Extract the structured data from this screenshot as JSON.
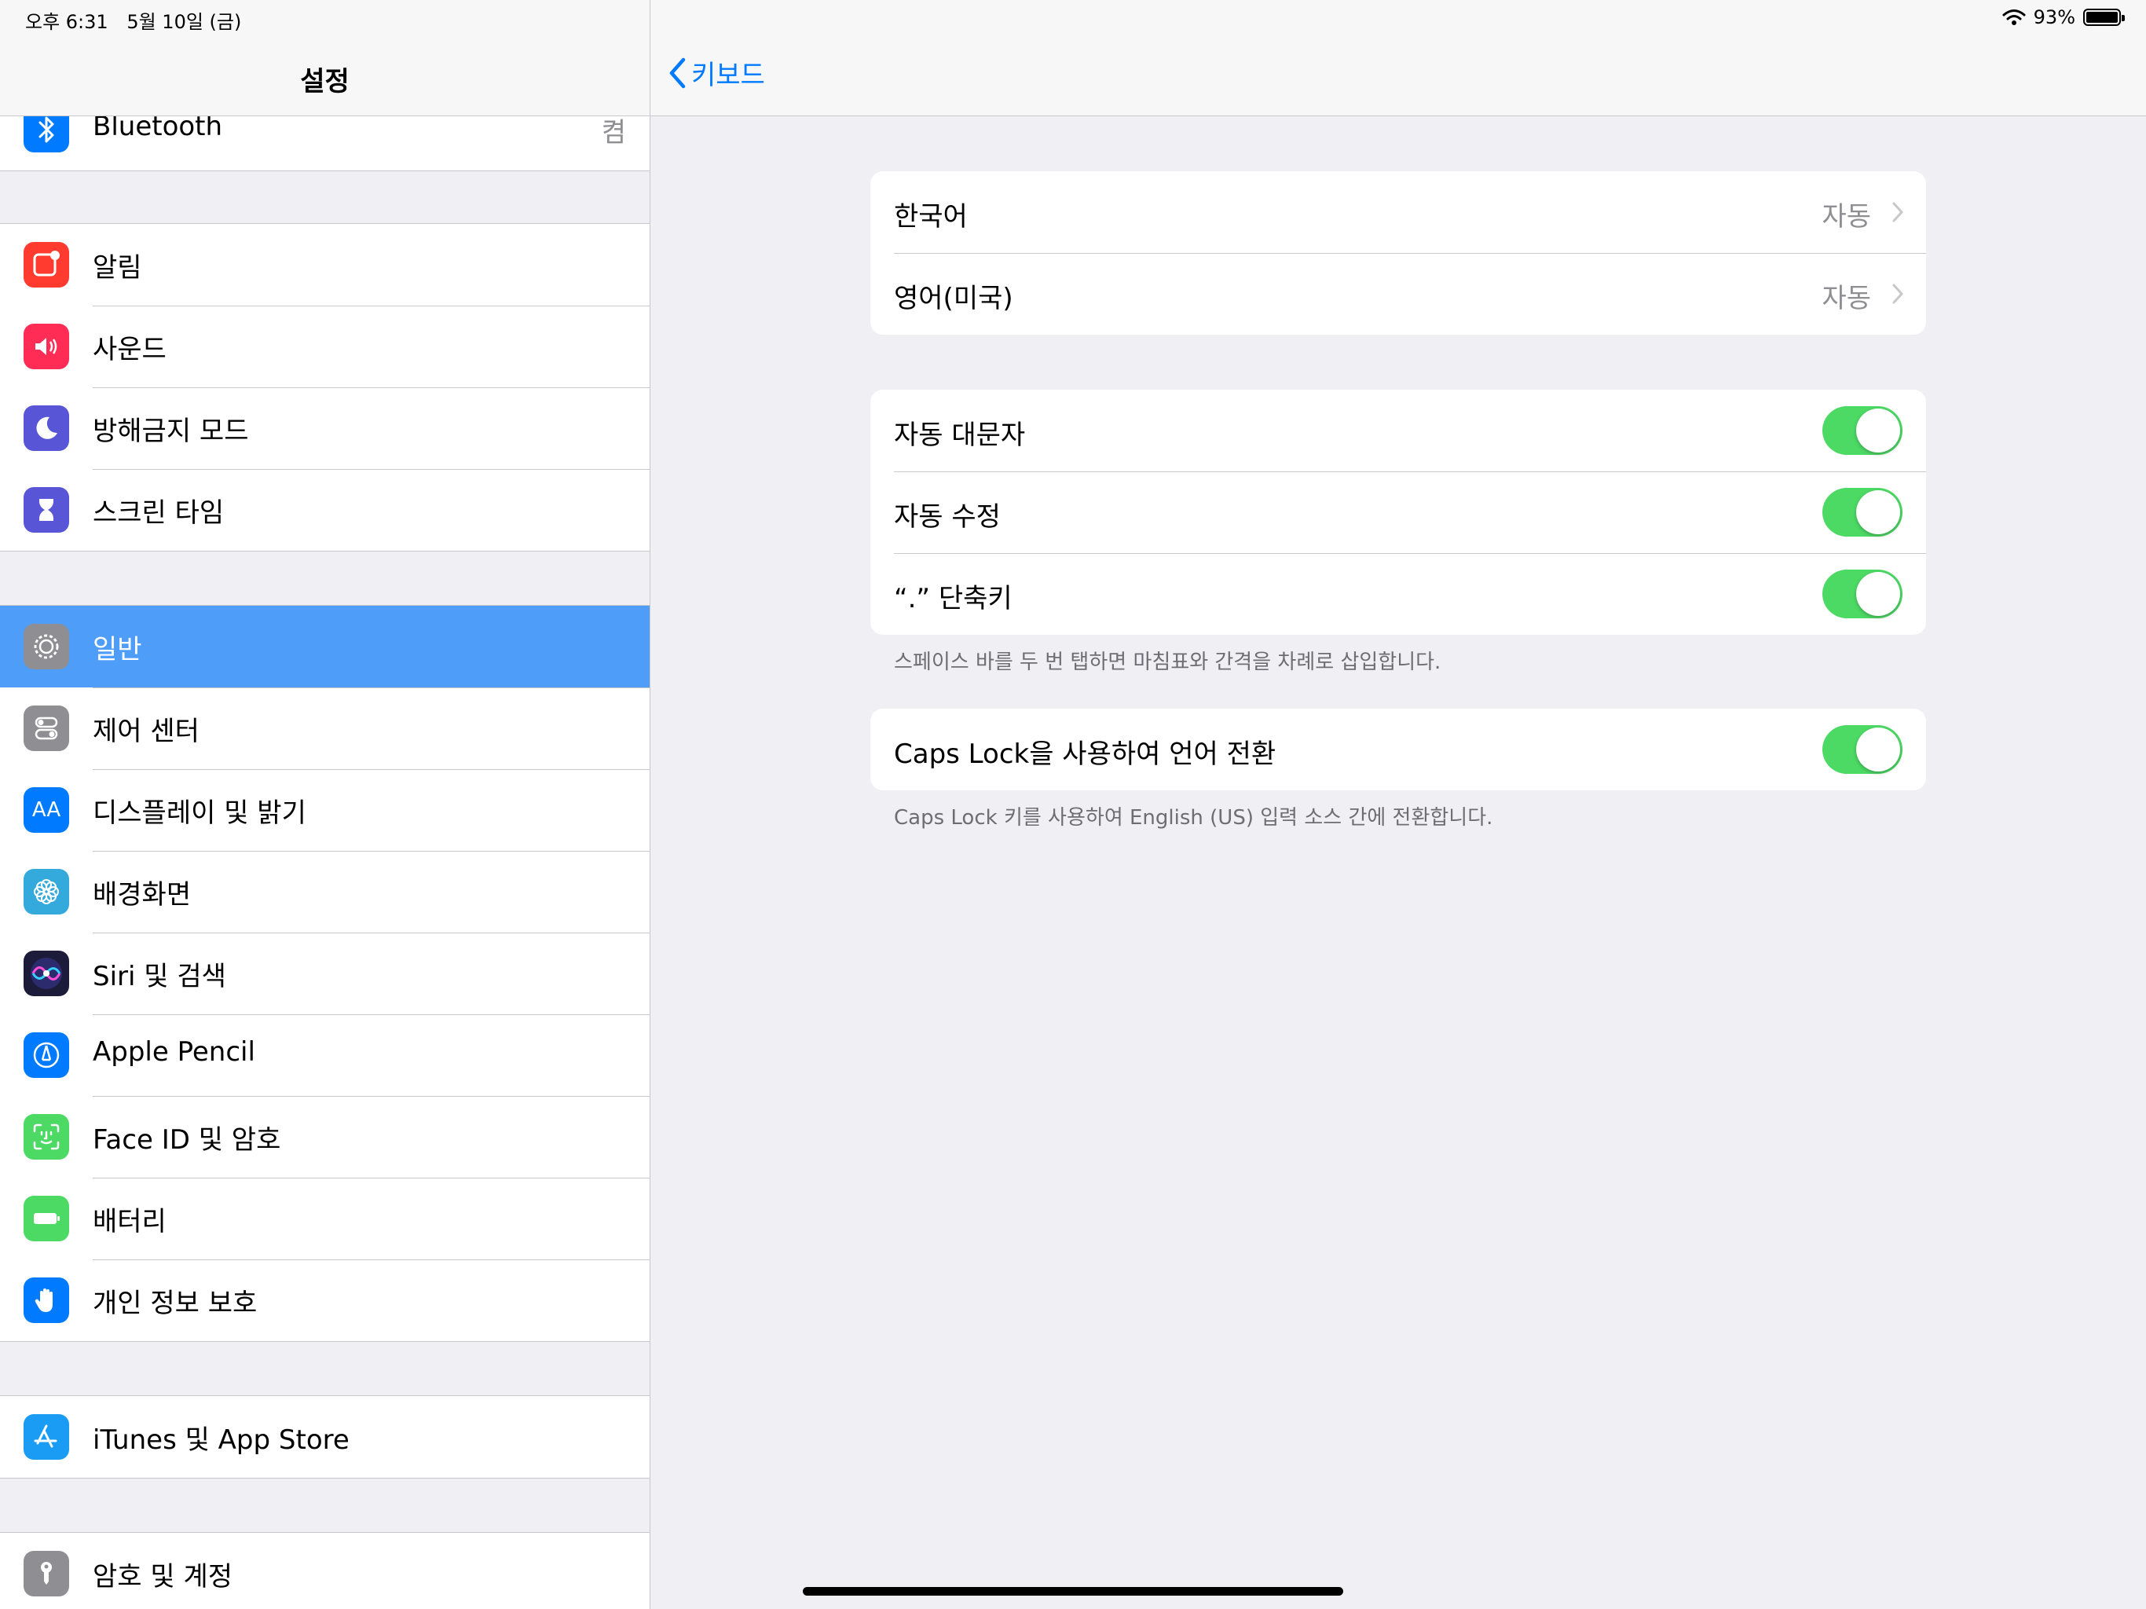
{
  "status": {
    "time": "오후 6:31",
    "date": "5월 10일 (금)",
    "battery": "93%"
  },
  "sidebar": {
    "title": "설정",
    "bluetooth": {
      "label": "Bluetooth",
      "value": "켬",
      "icon": "bluetooth-icon"
    },
    "group1": [
      {
        "label": "알림",
        "icon": "notifications-icon",
        "color": "#ff3b30"
      },
      {
        "label": "사운드",
        "icon": "sound-icon",
        "color": "#ff2d55"
      },
      {
        "label": "방해금지 모드",
        "icon": "moon-icon",
        "color": "#5856d6"
      },
      {
        "label": "스크린 타임",
        "icon": "hourglass-icon",
        "color": "#5856d6"
      }
    ],
    "group2": [
      {
        "label": "일반",
        "icon": "gear-icon",
        "color": "#8e8e93",
        "selected": true
      },
      {
        "label": "제어 센터",
        "icon": "control-center-icon",
        "color": "#8e8e93"
      },
      {
        "label": "디스플레이 및 밝기",
        "icon": "display-icon",
        "color": "#007aff",
        "glyph": "AA"
      },
      {
        "label": "배경화면",
        "icon": "wallpaper-icon",
        "color": "#34aadc"
      },
      {
        "label": "Siri 및 검색",
        "icon": "siri-icon",
        "color": "#1c1c3a"
      },
      {
        "label": "Apple Pencil",
        "icon": "pencil-icon",
        "color": "#007aff"
      },
      {
        "label": "Face ID 및 암호",
        "icon": "face-id-icon",
        "color": "#4cd964"
      },
      {
        "label": "배터리",
        "icon": "battery-icon",
        "color": "#4cd964"
      },
      {
        "label": "개인 정보 보호",
        "icon": "hand-icon",
        "color": "#007aff"
      }
    ],
    "group3": [
      {
        "label": "iTunes 및 App Store",
        "icon": "app-store-icon",
        "color": "#1a9cf4"
      }
    ],
    "group4": [
      {
        "label": "암호 및 계정",
        "icon": "key-icon",
        "color": "#8e8e93"
      }
    ]
  },
  "detail": {
    "back_label": "키보드",
    "languages": [
      {
        "label": "한국어",
        "value": "자동"
      },
      {
        "label": "영어(미국)",
        "value": "자동"
      }
    ],
    "toggles": [
      {
        "label": "자동 대문자",
        "on": true
      },
      {
        "label": "자동 수정",
        "on": true
      },
      {
        "label": "“.” 단축키",
        "on": true
      }
    ],
    "toggles_footer": "스페이스 바를 두 번 탭하면 마침표와 간격을 차례로 삽입합니다.",
    "caps": {
      "label": "Caps Lock을 사용하여 언어 전환",
      "on": true
    },
    "caps_footer": "Caps Lock 키를 사용하여 English (US) 입력 소스 간에 전환합니다."
  }
}
